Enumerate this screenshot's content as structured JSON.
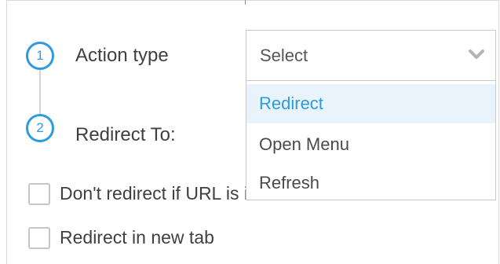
{
  "steps": [
    {
      "number": "1",
      "label": "Action type"
    },
    {
      "number": "2",
      "label": "Redirect To:"
    }
  ],
  "action_select": {
    "value": "Select",
    "icon": "chevron-down-icon",
    "options": [
      {
        "label": "Redirect",
        "highlighted": true
      },
      {
        "label": "Open Menu",
        "highlighted": false
      },
      {
        "label": "Refresh",
        "highlighted": false
      }
    ]
  },
  "checkboxes": [
    {
      "label": "Don't redirect if URL is identical",
      "checked": false
    },
    {
      "label": "Redirect in new tab",
      "checked": false
    }
  ],
  "colors": {
    "accent": "#2d9be0",
    "highlight_bg": "#e8f3fb"
  }
}
